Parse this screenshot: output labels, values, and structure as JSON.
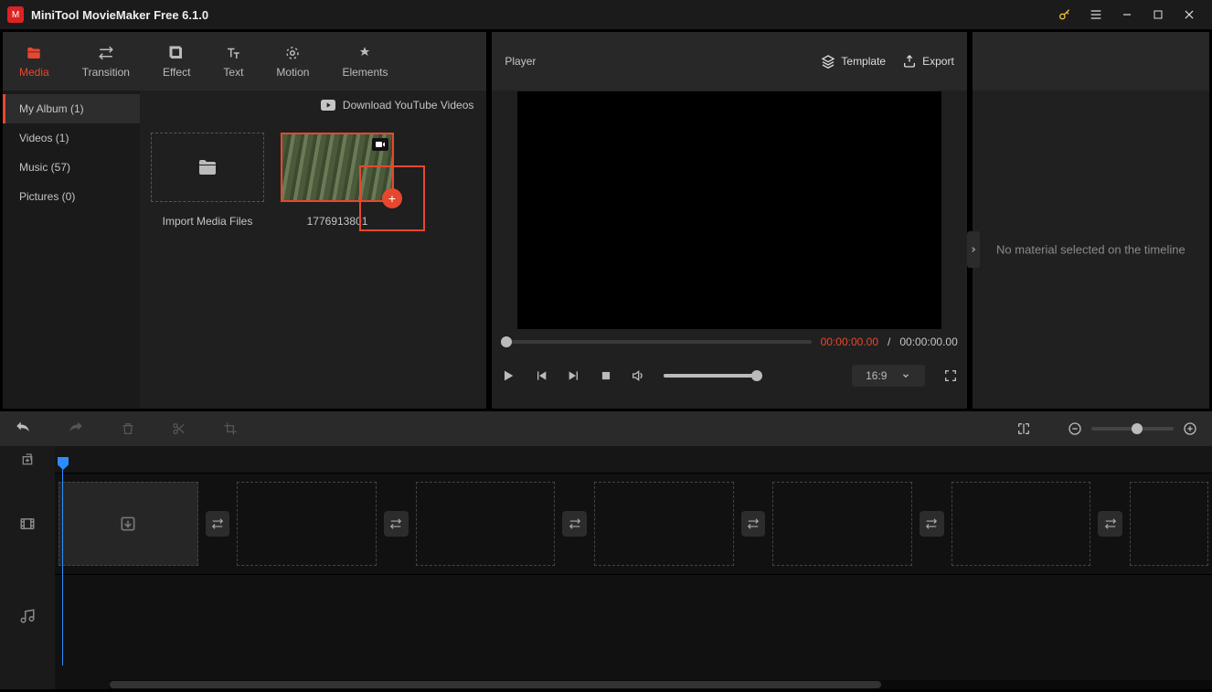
{
  "app": {
    "title": "MiniTool MovieMaker Free 6.1.0"
  },
  "tabs": {
    "media": "Media",
    "transition": "Transition",
    "effect": "Effect",
    "text": "Text",
    "motion": "Motion",
    "elements": "Elements"
  },
  "sidebar": {
    "my_album": "My Album (1)",
    "videos": "Videos (1)",
    "music": "Music (57)",
    "pictures": "Pictures (0)"
  },
  "media": {
    "download_yt": "Download YouTube Videos",
    "import_label": "Import Media Files",
    "clip1_name": "1776913801"
  },
  "player": {
    "label": "Player",
    "template": "Template",
    "export": "Export",
    "current": "00:00:00.00",
    "sep": " / ",
    "duration": "00:00:00.00",
    "aspect": "16:9"
  },
  "right": {
    "empty_msg": "No material selected on the timeline"
  }
}
